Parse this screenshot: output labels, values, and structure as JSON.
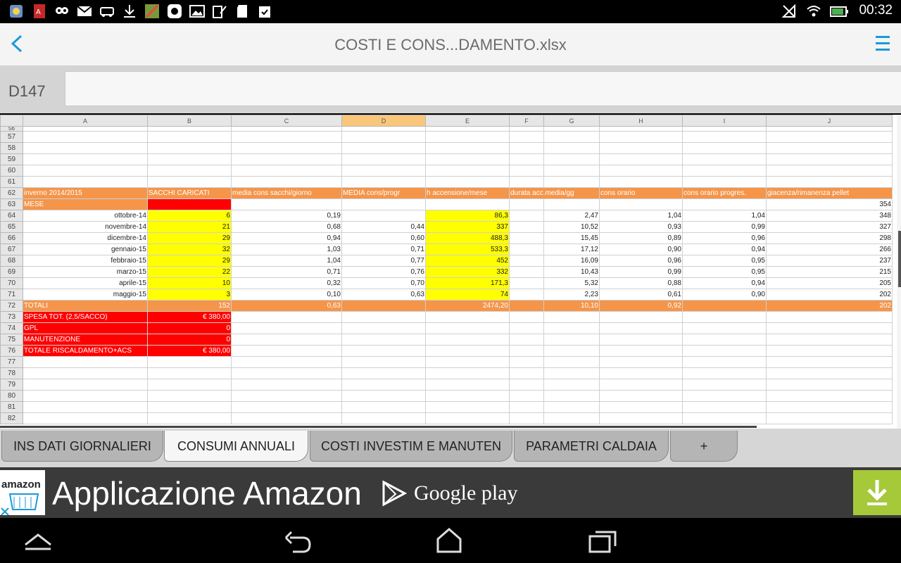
{
  "status_bar": {
    "time": "00:32"
  },
  "title_bar": {
    "title": "COSTI E CONS...DAMENTO.xlsx"
  },
  "formula_bar": {
    "cell_ref": "D147",
    "value": ""
  },
  "sheet": {
    "columns": [
      "A",
      "B",
      "C",
      "D",
      "E",
      "F",
      "G",
      "H",
      "I",
      "J"
    ],
    "selected_column": "D",
    "partial_top_row": "56",
    "rows": [
      {
        "n": "57",
        "cells": []
      },
      {
        "n": "58",
        "cells": []
      },
      {
        "n": "59",
        "cells": []
      },
      {
        "n": "60",
        "cells": []
      },
      {
        "n": "61",
        "cells": []
      },
      {
        "n": "62",
        "cells": [
          {
            "text": "inverno 2014/2015",
            "style": "orange"
          },
          {
            "text": "SACCHI CARICATI",
            "style": "orange"
          },
          {
            "text": "media cons sacchi/giorno",
            "style": "orange"
          },
          {
            "text": "MEDIA cons/progr",
            "style": "orange"
          },
          {
            "text": "h accensione/mese",
            "style": "orange"
          },
          {
            "text": "durata acc.media/gg",
            "style": "orange",
            "colspan": 2
          },
          {
            "text": "cons orario",
            "style": "orange"
          },
          {
            "text": "cons orario progres.",
            "style": "orange"
          },
          {
            "text": "giacenza/rimanenza pellet",
            "style": "orange"
          }
        ]
      },
      {
        "n": "63",
        "cells": [
          {
            "text": "MESE",
            "style": "orange"
          },
          {
            "text": "",
            "style": "red"
          },
          {
            "text": ""
          },
          {
            "text": ""
          },
          {
            "text": ""
          },
          {
            "text": ""
          },
          {
            "text": ""
          },
          {
            "text": ""
          },
          {
            "text": ""
          },
          {
            "text": "354",
            "num": true
          }
        ]
      },
      {
        "n": "64",
        "cells": [
          {
            "text": "ottobre-14",
            "num": true
          },
          {
            "text": "6",
            "num": true,
            "style": "yellow"
          },
          {
            "text": "0,19",
            "num": true
          },
          {
            "text": ""
          },
          {
            "text": "86,3",
            "num": true,
            "style": "yellow"
          },
          {
            "text": ""
          },
          {
            "text": "2,47",
            "num": true
          },
          {
            "text": "1,04",
            "num": true
          },
          {
            "text": "1,04",
            "num": true
          },
          {
            "text": "348",
            "num": true
          }
        ]
      },
      {
        "n": "65",
        "cells": [
          {
            "text": "novembre-14",
            "num": true
          },
          {
            "text": "21",
            "num": true,
            "style": "yellow"
          },
          {
            "text": "0,68",
            "num": true
          },
          {
            "text": "0,44",
            "num": true
          },
          {
            "text": "337",
            "num": true,
            "style": "yellow"
          },
          {
            "text": ""
          },
          {
            "text": "10,52",
            "num": true
          },
          {
            "text": "0,93",
            "num": true
          },
          {
            "text": "0,99",
            "num": true
          },
          {
            "text": "327",
            "num": true
          }
        ]
      },
      {
        "n": "66",
        "cells": [
          {
            "text": "dicembre-14",
            "num": true
          },
          {
            "text": "29",
            "num": true,
            "style": "yellow"
          },
          {
            "text": "0,94",
            "num": true
          },
          {
            "text": "0,60",
            "num": true
          },
          {
            "text": "488,3",
            "num": true,
            "style": "yellow"
          },
          {
            "text": ""
          },
          {
            "text": "15,45",
            "num": true
          },
          {
            "text": "0,89",
            "num": true
          },
          {
            "text": "0,96",
            "num": true
          },
          {
            "text": "298",
            "num": true
          }
        ]
      },
      {
        "n": "67",
        "cells": [
          {
            "text": "gennaio-15",
            "num": true
          },
          {
            "text": "32",
            "num": true,
            "style": "yellow"
          },
          {
            "text": "1,03",
            "num": true
          },
          {
            "text": "0,71",
            "num": true
          },
          {
            "text": "533,3",
            "num": true,
            "style": "yellow"
          },
          {
            "text": ""
          },
          {
            "text": "17,12",
            "num": true
          },
          {
            "text": "0,90",
            "num": true
          },
          {
            "text": "0,94",
            "num": true
          },
          {
            "text": "266",
            "num": true
          }
        ]
      },
      {
        "n": "68",
        "cells": [
          {
            "text": "febbraio-15",
            "num": true
          },
          {
            "text": "29",
            "num": true,
            "style": "yellow"
          },
          {
            "text": "1,04",
            "num": true
          },
          {
            "text": "0,77",
            "num": true
          },
          {
            "text": "452",
            "num": true,
            "style": "yellow"
          },
          {
            "text": ""
          },
          {
            "text": "16,09",
            "num": true
          },
          {
            "text": "0,96",
            "num": true
          },
          {
            "text": "0,95",
            "num": true
          },
          {
            "text": "237",
            "num": true
          }
        ]
      },
      {
        "n": "69",
        "cells": [
          {
            "text": "marzo-15",
            "num": true
          },
          {
            "text": "22",
            "num": true,
            "style": "yellow"
          },
          {
            "text": "0,71",
            "num": true
          },
          {
            "text": "0,76",
            "num": true
          },
          {
            "text": "332",
            "num": true,
            "style": "yellow"
          },
          {
            "text": ""
          },
          {
            "text": "10,43",
            "num": true
          },
          {
            "text": "0,99",
            "num": true
          },
          {
            "text": "0,95",
            "num": true
          },
          {
            "text": "215",
            "num": true
          }
        ]
      },
      {
        "n": "70",
        "cells": [
          {
            "text": "aprile-15",
            "num": true
          },
          {
            "text": "10",
            "num": true,
            "style": "yellow"
          },
          {
            "text": "0,32",
            "num": true
          },
          {
            "text": "0,70",
            "num": true
          },
          {
            "text": "171,3",
            "num": true,
            "style": "yellow"
          },
          {
            "text": ""
          },
          {
            "text": "5,32",
            "num": true
          },
          {
            "text": "0,88",
            "num": true
          },
          {
            "text": "0,94",
            "num": true
          },
          {
            "text": "205",
            "num": true
          }
        ]
      },
      {
        "n": "71",
        "cells": [
          {
            "text": "maggio-15",
            "num": true
          },
          {
            "text": "3",
            "num": true,
            "style": "yellow"
          },
          {
            "text": "0,10",
            "num": true
          },
          {
            "text": "0,63",
            "num": true
          },
          {
            "text": "74",
            "num": true,
            "style": "yellow"
          },
          {
            "text": ""
          },
          {
            "text": "2,23",
            "num": true
          },
          {
            "text": "0,61",
            "num": true
          },
          {
            "text": "0,90",
            "num": true
          },
          {
            "text": "202",
            "num": true
          }
        ]
      },
      {
        "n": "72",
        "cells": [
          {
            "text": "TOTALI",
            "style": "orange"
          },
          {
            "text": "152",
            "num": true,
            "style": "orange"
          },
          {
            "text": "0,63",
            "num": true,
            "style": "orange"
          },
          {
            "text": "",
            "style": "orange"
          },
          {
            "text": "2474,20",
            "num": true,
            "style": "orange"
          },
          {
            "text": "",
            "style": "orange"
          },
          {
            "text": "10,10",
            "num": true,
            "style": "orange"
          },
          {
            "text": "0,92",
            "num": true,
            "style": "orange"
          },
          {
            "text": "",
            "style": "orange"
          },
          {
            "text": "202",
            "num": true,
            "style": "orange"
          }
        ]
      },
      {
        "n": "73",
        "cells": [
          {
            "text": "SPESA TOT. (2,5/SACCO)",
            "style": "red"
          },
          {
            "text": "€ 380,00",
            "num": true,
            "style": "red"
          }
        ]
      },
      {
        "n": "74",
        "cells": [
          {
            "text": "GPL",
            "style": "red"
          },
          {
            "text": "0",
            "num": true,
            "style": "red"
          }
        ]
      },
      {
        "n": "75",
        "cells": [
          {
            "text": "MANUTENZIONE",
            "style": "red"
          },
          {
            "text": "0",
            "num": true,
            "style": "red"
          }
        ]
      },
      {
        "n": "76",
        "cells": [
          {
            "text": "TOTALE RISCALDAMENTO+ACS",
            "style": "red"
          },
          {
            "text": "€ 380,00",
            "num": true,
            "style": "red"
          }
        ]
      },
      {
        "n": "77",
        "cells": []
      },
      {
        "n": "78",
        "cells": []
      },
      {
        "n": "79",
        "cells": []
      },
      {
        "n": "80",
        "cells": []
      },
      {
        "n": "81",
        "cells": []
      },
      {
        "n": "82",
        "cells": []
      }
    ]
  },
  "tabs": [
    {
      "label": "INS DATI GIORNALIERI",
      "active": false
    },
    {
      "label": "CONSUMI ANNUALI",
      "active": true
    },
    {
      "label": "COSTI INVESTIM E MANUTEN",
      "active": false
    },
    {
      "label": "PARAMETRI CALDAIA",
      "active": false
    },
    {
      "label": "+",
      "active": false
    }
  ],
  "ad": {
    "logo_text": "amazon",
    "headline": "Applicazione Amazon",
    "store": "Google play"
  },
  "colors": {
    "orange": "#f4954a",
    "red": "#ff0000",
    "yellow": "#ffff00",
    "accent_blue": "#1a9ad6",
    "download_green": "#a6c93a"
  }
}
